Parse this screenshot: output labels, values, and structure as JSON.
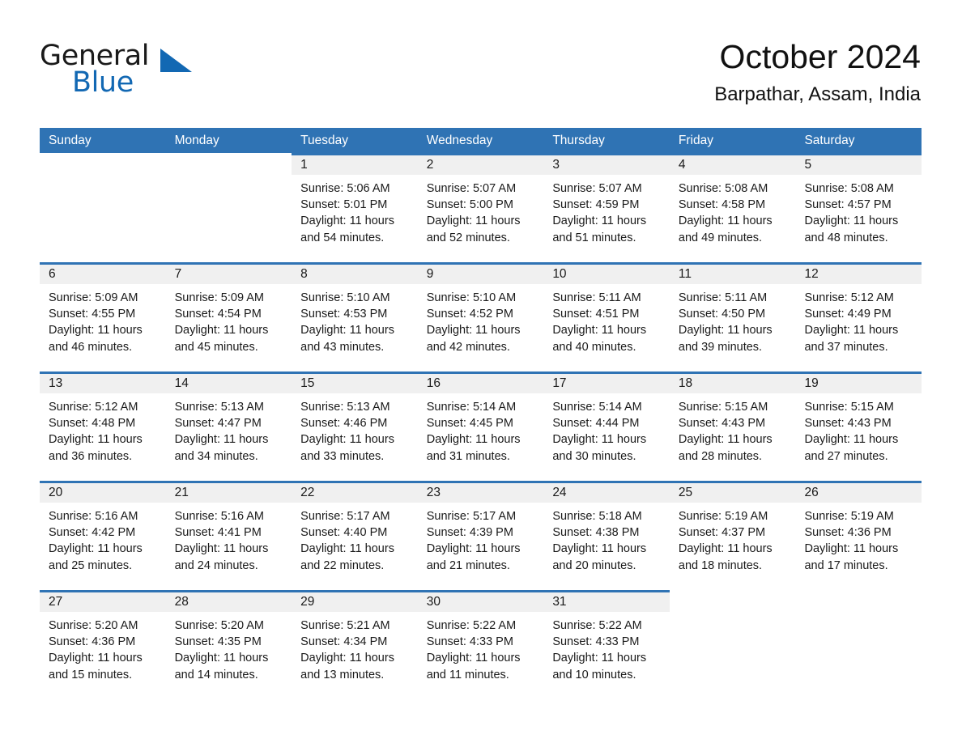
{
  "brand": {
    "name_part1": "General",
    "name_part2": "Blue",
    "triangle_icon": "triangle-icon",
    "accent_color": "#1268b3"
  },
  "header": {
    "title": "October 2024",
    "location": "Barpathar, Assam, India"
  },
  "theme": {
    "header_blue": "#2f73b4",
    "daynum_band": "#f0f0f0",
    "text": "#1a1a1a"
  },
  "calendar": {
    "weekdays": [
      "Sunday",
      "Monday",
      "Tuesday",
      "Wednesday",
      "Thursday",
      "Friday",
      "Saturday"
    ],
    "weeks": [
      [
        {
          "blank": true
        },
        {
          "blank": true
        },
        {
          "day": "1",
          "sunrise": "Sunrise: 5:06 AM",
          "sunset": "Sunset: 5:01 PM",
          "daylight_line1": "Daylight: 11 hours",
          "daylight_line2": "and 54 minutes."
        },
        {
          "day": "2",
          "sunrise": "Sunrise: 5:07 AM",
          "sunset": "Sunset: 5:00 PM",
          "daylight_line1": "Daylight: 11 hours",
          "daylight_line2": "and 52 minutes."
        },
        {
          "day": "3",
          "sunrise": "Sunrise: 5:07 AM",
          "sunset": "Sunset: 4:59 PM",
          "daylight_line1": "Daylight: 11 hours",
          "daylight_line2": "and 51 minutes."
        },
        {
          "day": "4",
          "sunrise": "Sunrise: 5:08 AM",
          "sunset": "Sunset: 4:58 PM",
          "daylight_line1": "Daylight: 11 hours",
          "daylight_line2": "and 49 minutes."
        },
        {
          "day": "5",
          "sunrise": "Sunrise: 5:08 AM",
          "sunset": "Sunset: 4:57 PM",
          "daylight_line1": "Daylight: 11 hours",
          "daylight_line2": "and 48 minutes."
        }
      ],
      [
        {
          "day": "6",
          "sunrise": "Sunrise: 5:09 AM",
          "sunset": "Sunset: 4:55 PM",
          "daylight_line1": "Daylight: 11 hours",
          "daylight_line2": "and 46 minutes."
        },
        {
          "day": "7",
          "sunrise": "Sunrise: 5:09 AM",
          "sunset": "Sunset: 4:54 PM",
          "daylight_line1": "Daylight: 11 hours",
          "daylight_line2": "and 45 minutes."
        },
        {
          "day": "8",
          "sunrise": "Sunrise: 5:10 AM",
          "sunset": "Sunset: 4:53 PM",
          "daylight_line1": "Daylight: 11 hours",
          "daylight_line2": "and 43 minutes."
        },
        {
          "day": "9",
          "sunrise": "Sunrise: 5:10 AM",
          "sunset": "Sunset: 4:52 PM",
          "daylight_line1": "Daylight: 11 hours",
          "daylight_line2": "and 42 minutes."
        },
        {
          "day": "10",
          "sunrise": "Sunrise: 5:11 AM",
          "sunset": "Sunset: 4:51 PM",
          "daylight_line1": "Daylight: 11 hours",
          "daylight_line2": "and 40 minutes."
        },
        {
          "day": "11",
          "sunrise": "Sunrise: 5:11 AM",
          "sunset": "Sunset: 4:50 PM",
          "daylight_line1": "Daylight: 11 hours",
          "daylight_line2": "and 39 minutes."
        },
        {
          "day": "12",
          "sunrise": "Sunrise: 5:12 AM",
          "sunset": "Sunset: 4:49 PM",
          "daylight_line1": "Daylight: 11 hours",
          "daylight_line2": "and 37 minutes."
        }
      ],
      [
        {
          "day": "13",
          "sunrise": "Sunrise: 5:12 AM",
          "sunset": "Sunset: 4:48 PM",
          "daylight_line1": "Daylight: 11 hours",
          "daylight_line2": "and 36 minutes."
        },
        {
          "day": "14",
          "sunrise": "Sunrise: 5:13 AM",
          "sunset": "Sunset: 4:47 PM",
          "daylight_line1": "Daylight: 11 hours",
          "daylight_line2": "and 34 minutes."
        },
        {
          "day": "15",
          "sunrise": "Sunrise: 5:13 AM",
          "sunset": "Sunset: 4:46 PM",
          "daylight_line1": "Daylight: 11 hours",
          "daylight_line2": "and 33 minutes."
        },
        {
          "day": "16",
          "sunrise": "Sunrise: 5:14 AM",
          "sunset": "Sunset: 4:45 PM",
          "daylight_line1": "Daylight: 11 hours",
          "daylight_line2": "and 31 minutes."
        },
        {
          "day": "17",
          "sunrise": "Sunrise: 5:14 AM",
          "sunset": "Sunset: 4:44 PM",
          "daylight_line1": "Daylight: 11 hours",
          "daylight_line2": "and 30 minutes."
        },
        {
          "day": "18",
          "sunrise": "Sunrise: 5:15 AM",
          "sunset": "Sunset: 4:43 PM",
          "daylight_line1": "Daylight: 11 hours",
          "daylight_line2": "and 28 minutes."
        },
        {
          "day": "19",
          "sunrise": "Sunrise: 5:15 AM",
          "sunset": "Sunset: 4:43 PM",
          "daylight_line1": "Daylight: 11 hours",
          "daylight_line2": "and 27 minutes."
        }
      ],
      [
        {
          "day": "20",
          "sunrise": "Sunrise: 5:16 AM",
          "sunset": "Sunset: 4:42 PM",
          "daylight_line1": "Daylight: 11 hours",
          "daylight_line2": "and 25 minutes."
        },
        {
          "day": "21",
          "sunrise": "Sunrise: 5:16 AM",
          "sunset": "Sunset: 4:41 PM",
          "daylight_line1": "Daylight: 11 hours",
          "daylight_line2": "and 24 minutes."
        },
        {
          "day": "22",
          "sunrise": "Sunrise: 5:17 AM",
          "sunset": "Sunset: 4:40 PM",
          "daylight_line1": "Daylight: 11 hours",
          "daylight_line2": "and 22 minutes."
        },
        {
          "day": "23",
          "sunrise": "Sunrise: 5:17 AM",
          "sunset": "Sunset: 4:39 PM",
          "daylight_line1": "Daylight: 11 hours",
          "daylight_line2": "and 21 minutes."
        },
        {
          "day": "24",
          "sunrise": "Sunrise: 5:18 AM",
          "sunset": "Sunset: 4:38 PM",
          "daylight_line1": "Daylight: 11 hours",
          "daylight_line2": "and 20 minutes."
        },
        {
          "day": "25",
          "sunrise": "Sunrise: 5:19 AM",
          "sunset": "Sunset: 4:37 PM",
          "daylight_line1": "Daylight: 11 hours",
          "daylight_line2": "and 18 minutes."
        },
        {
          "day": "26",
          "sunrise": "Sunrise: 5:19 AM",
          "sunset": "Sunset: 4:36 PM",
          "daylight_line1": "Daylight: 11 hours",
          "daylight_line2": "and 17 minutes."
        }
      ],
      [
        {
          "day": "27",
          "sunrise": "Sunrise: 5:20 AM",
          "sunset": "Sunset: 4:36 PM",
          "daylight_line1": "Daylight: 11 hours",
          "daylight_line2": "and 15 minutes."
        },
        {
          "day": "28",
          "sunrise": "Sunrise: 5:20 AM",
          "sunset": "Sunset: 4:35 PM",
          "daylight_line1": "Daylight: 11 hours",
          "daylight_line2": "and 14 minutes."
        },
        {
          "day": "29",
          "sunrise": "Sunrise: 5:21 AM",
          "sunset": "Sunset: 4:34 PM",
          "daylight_line1": "Daylight: 11 hours",
          "daylight_line2": "and 13 minutes."
        },
        {
          "day": "30",
          "sunrise": "Sunrise: 5:22 AM",
          "sunset": "Sunset: 4:33 PM",
          "daylight_line1": "Daylight: 11 hours",
          "daylight_line2": "and 11 minutes."
        },
        {
          "day": "31",
          "sunrise": "Sunrise: 5:22 AM",
          "sunset": "Sunset: 4:33 PM",
          "daylight_line1": "Daylight: 11 hours",
          "daylight_line2": "and 10 minutes."
        },
        {
          "blank": true
        },
        {
          "blank": true
        }
      ]
    ]
  }
}
